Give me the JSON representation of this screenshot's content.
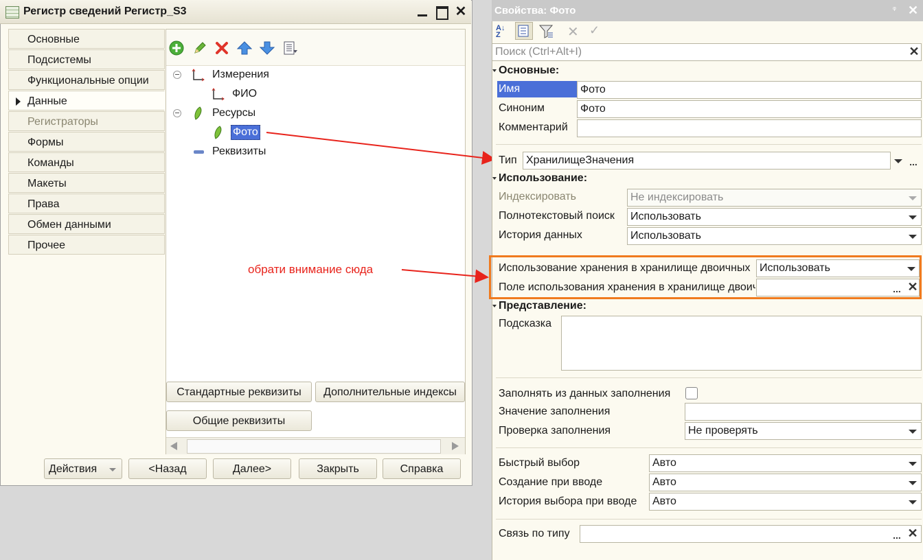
{
  "left_window": {
    "title": "Регистр сведений Регистр_S3",
    "controls": {
      "minimize": "—",
      "maximize": "☐",
      "close": "✕"
    },
    "nav": [
      {
        "label": "Основные",
        "active": false,
        "disabled": false
      },
      {
        "label": "Подсистемы",
        "active": false,
        "disabled": false
      },
      {
        "label": "Функциональные опции",
        "active": false,
        "disabled": false
      },
      {
        "label": "Данные",
        "active": true,
        "disabled": false
      },
      {
        "label": "Регистраторы",
        "active": false,
        "disabled": true
      },
      {
        "label": "Формы",
        "active": false,
        "disabled": false
      },
      {
        "label": "Команды",
        "active": false,
        "disabled": false
      },
      {
        "label": "Макеты",
        "active": false,
        "disabled": false
      },
      {
        "label": "Права",
        "active": false,
        "disabled": false
      },
      {
        "label": "Обмен данными",
        "active": false,
        "disabled": false
      },
      {
        "label": "Прочее",
        "active": false,
        "disabled": false
      }
    ],
    "toolbar_icons": [
      "add-icon",
      "edit-icon",
      "delete-icon",
      "move-up-icon",
      "move-down-icon",
      "list-icon"
    ],
    "tree": {
      "dimensions": "Измерения",
      "dimension_item": "ФИО",
      "resources": "Ресурсы",
      "resource_item": "Фото",
      "attributes": "Реквизиты"
    },
    "buttons": {
      "standard_attributes": "Стандартные реквизиты",
      "additional_indexes": "Дополнительные индексы",
      "common_attributes": "Общие реквизиты"
    },
    "footer": {
      "actions": "Действия",
      "back": "<Назад",
      "next": "Далее>",
      "close": "Закрыть",
      "help": "Справка"
    }
  },
  "annotation": {
    "text": "обрати внимание сюда",
    "color": "#e8231b"
  },
  "properties": {
    "title": "Свойства: Фото",
    "search_placeholder": "Поиск (Ctrl+Alt+I)",
    "sections": {
      "main": "Основные:",
      "usage": "Использование:",
      "presentation": "Представление:"
    },
    "labels": {
      "name": "Имя",
      "synonym": "Синоним",
      "comment": "Комментарий",
      "type": "Тип",
      "index": "Индексировать",
      "fulltext": "Полнотекстовый поиск",
      "history": "История данных",
      "binary_storage": "Использование хранения в хранилище двоичных",
      "binary_field": "Поле использования хранения в хранилище двоичных",
      "tooltip": "Подсказка",
      "fill_from": "Заполнять из данных заполнения",
      "fill_value": "Значение заполнения",
      "fill_check": "Проверка заполнения",
      "quick_choice": "Быстрый выбор",
      "create_on_input": "Создание при вводе",
      "choice_history": "История выбора при вводе",
      "link_by_type": "Связь по типу"
    },
    "values": {
      "name": "Фото",
      "synonym": "Фото",
      "comment": "",
      "type": "ХранилищеЗначения",
      "index": "Не индексировать",
      "fulltext": "Использовать",
      "history": "Использовать",
      "binary_storage": "Использовать",
      "binary_field": "",
      "tooltip": "",
      "fill_value": "",
      "fill_check": "Не проверять",
      "quick_choice": "Авто",
      "create_on_input": "Авто",
      "choice_history": "Авто",
      "link_by_type": ""
    },
    "highlight_color": "#f07a1e",
    "selection_color": "#4a6fd8"
  }
}
